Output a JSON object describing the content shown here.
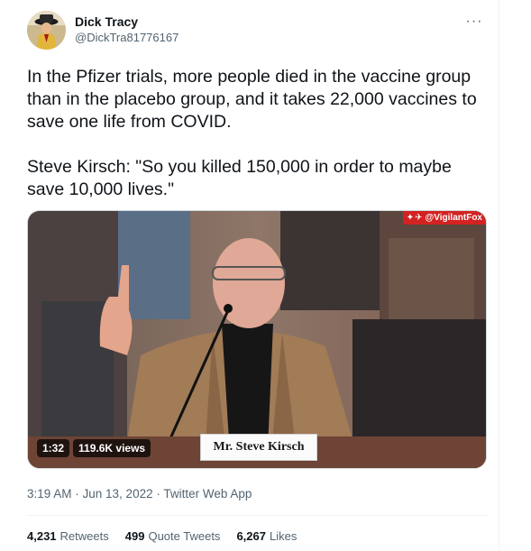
{
  "author": {
    "display_name": "Dick Tracy",
    "handle": "@DickTra81776167"
  },
  "tweet_text": "In the Pfizer trials, more people died in the vaccine group than in the placebo group, and it takes 22,000 vaccines to save one life from COVID.\n\nSteve Kirsch: \"So you killed 150,000 in order to maybe save 10,000 lives.\"",
  "media": {
    "duration": "1:32",
    "views": "119.6K views",
    "nameplate": "Mr. Steve Kirsch",
    "watermark": "@VigilantFox"
  },
  "timestamp": "3:19 AM · Jun 13, 2022 · Twitter Web App",
  "stats": {
    "retweets": {
      "count": "4,231",
      "label": "Retweets"
    },
    "quote_tweets": {
      "count": "499",
      "label": "Quote Tweets"
    },
    "likes": {
      "count": "6,267",
      "label": "Likes"
    }
  },
  "icons": {
    "more": "more-icon",
    "avatar": "avatar"
  }
}
